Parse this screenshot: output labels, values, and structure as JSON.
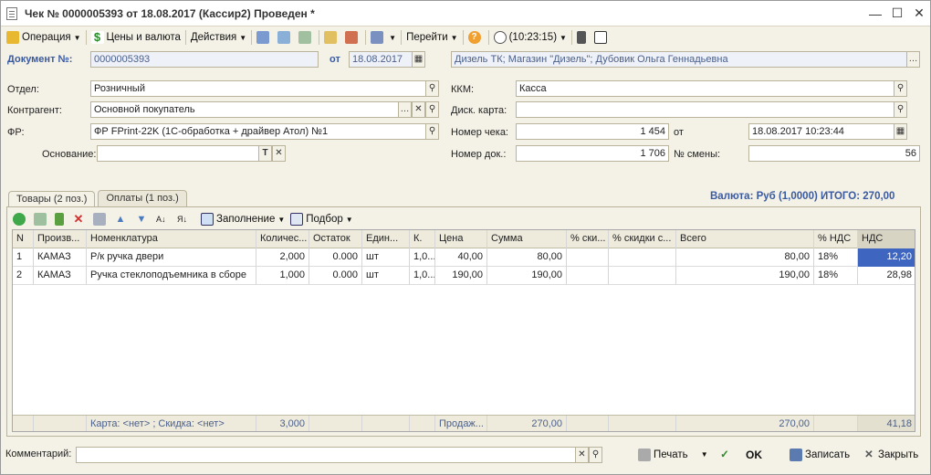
{
  "window": {
    "title": "Чек № 0000005393 от 18.08.2017 (Кассир2) Проведен *"
  },
  "toolbar": {
    "operation": "Операция",
    "prices": "Цены и валюта",
    "actions": "Действия",
    "goto": "Перейти",
    "time": "(10:23:15)"
  },
  "doc": {
    "number_label": "Документ №:",
    "number": "0000005393",
    "date_label": "от",
    "date": "18.08.2017",
    "org": "Дизель ТК; Магазин \"Дизель\"; Дубовик Ольга Геннадьевна"
  },
  "form": {
    "otdel_label": "Отдел:",
    "otdel": "Розничный",
    "kontragent_label": "Контрагент:",
    "kontragent": "Основной покупатель",
    "fr_label": "ФР:",
    "fr": "ФР FPrint-22K (1С-обработка + драйвер Атол) №1",
    "osnovanie_label": "Основание:",
    "osnovanie": "",
    "kkm_label": "ККМ:",
    "kkm": "Касса",
    "disk_label": "Диск. карта:",
    "disk": "",
    "check_num_label": "Номер чека:",
    "check_num": "1 454",
    "check_date_label": "от",
    "check_date": "18.08.2017 10:23:44",
    "doc_num_label": "Номер док.:",
    "doc_num": "1 706",
    "shift_label": "№ смены:",
    "shift": "56"
  },
  "tabs": [
    {
      "label": "Товары (2 поз.)"
    },
    {
      "label": "Оплаты (1 поз.)"
    }
  ],
  "currency_total": "Валюта: Руб (1,0000) ИТОГО: 270,00",
  "table_toolbar": {
    "fill": "Заполнение",
    "select": "Подбор"
  },
  "table": {
    "columns": [
      "N",
      "Произв...",
      "Номенклатура",
      "Количес...",
      "Остаток",
      "Един...",
      "К.",
      "Цена",
      "Сумма",
      "% ски...",
      "% скидки с...",
      "Всего",
      "% НДС",
      "НДС"
    ],
    "rows": [
      [
        "1",
        "КАМАЗ",
        "Р/к ручка двери",
        "2,000",
        "0.000",
        "шт",
        "1,0...",
        "40,00",
        "80,00",
        "",
        "",
        "80,00",
        "18%",
        "12,20"
      ],
      [
        "2",
        "КАМАЗ",
        "Ручка стеклоподъемника в сборе",
        "1,000",
        "0.000",
        "шт",
        "1,0...",
        "190,00",
        "190,00",
        "",
        "",
        "190,00",
        "18%",
        "28,98"
      ]
    ],
    "footer": [
      "",
      "",
      "Карта: <нет> ; Скидка: <нет>",
      "3,000",
      "",
      "",
      "",
      "Продаж...",
      "270,00",
      "",
      "",
      "270,00",
      "",
      "41,18"
    ]
  },
  "bottom": {
    "comment_label": "Комментарий:",
    "comment": "",
    "print": "Печать",
    "ok": "OK",
    "save": "Записать",
    "close": "Закрыть"
  },
  "colors": {
    "accent": "#3e66c0",
    "label_blue": "#3a5aa0",
    "background": "#f4f1e6"
  }
}
